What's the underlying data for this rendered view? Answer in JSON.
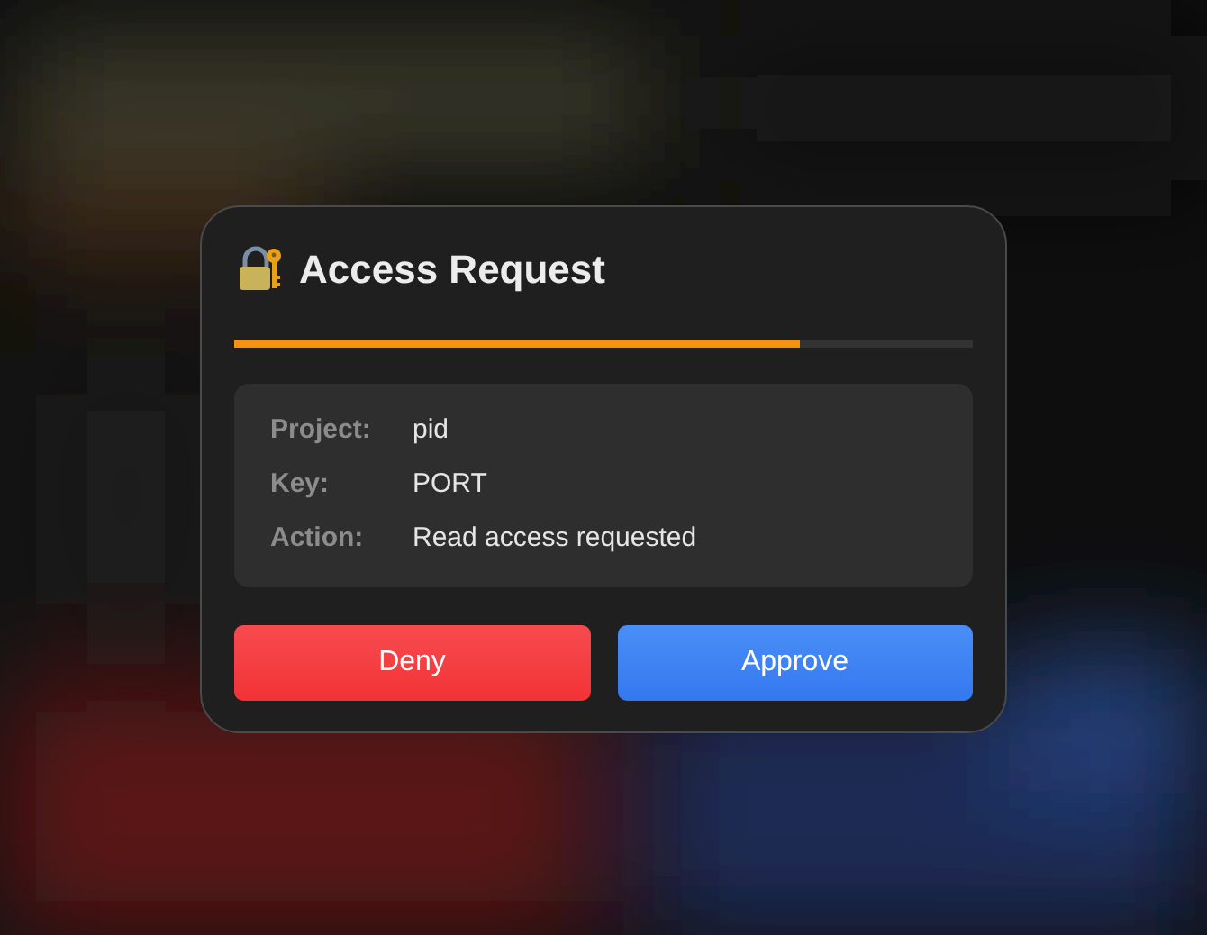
{
  "dialog": {
    "title": "Access Request",
    "progress": {
      "level": 0.765
    },
    "details": [
      {
        "label": "Project:",
        "value": "pid"
      },
      {
        "label": "Key:",
        "value": "PORT"
      },
      {
        "label": "Action:",
        "value": "Read access requested"
      }
    ],
    "buttons": [
      {
        "label": "Deny",
        "kind": "deny"
      },
      {
        "label": "Approve",
        "kind": "approve"
      }
    ]
  }
}
